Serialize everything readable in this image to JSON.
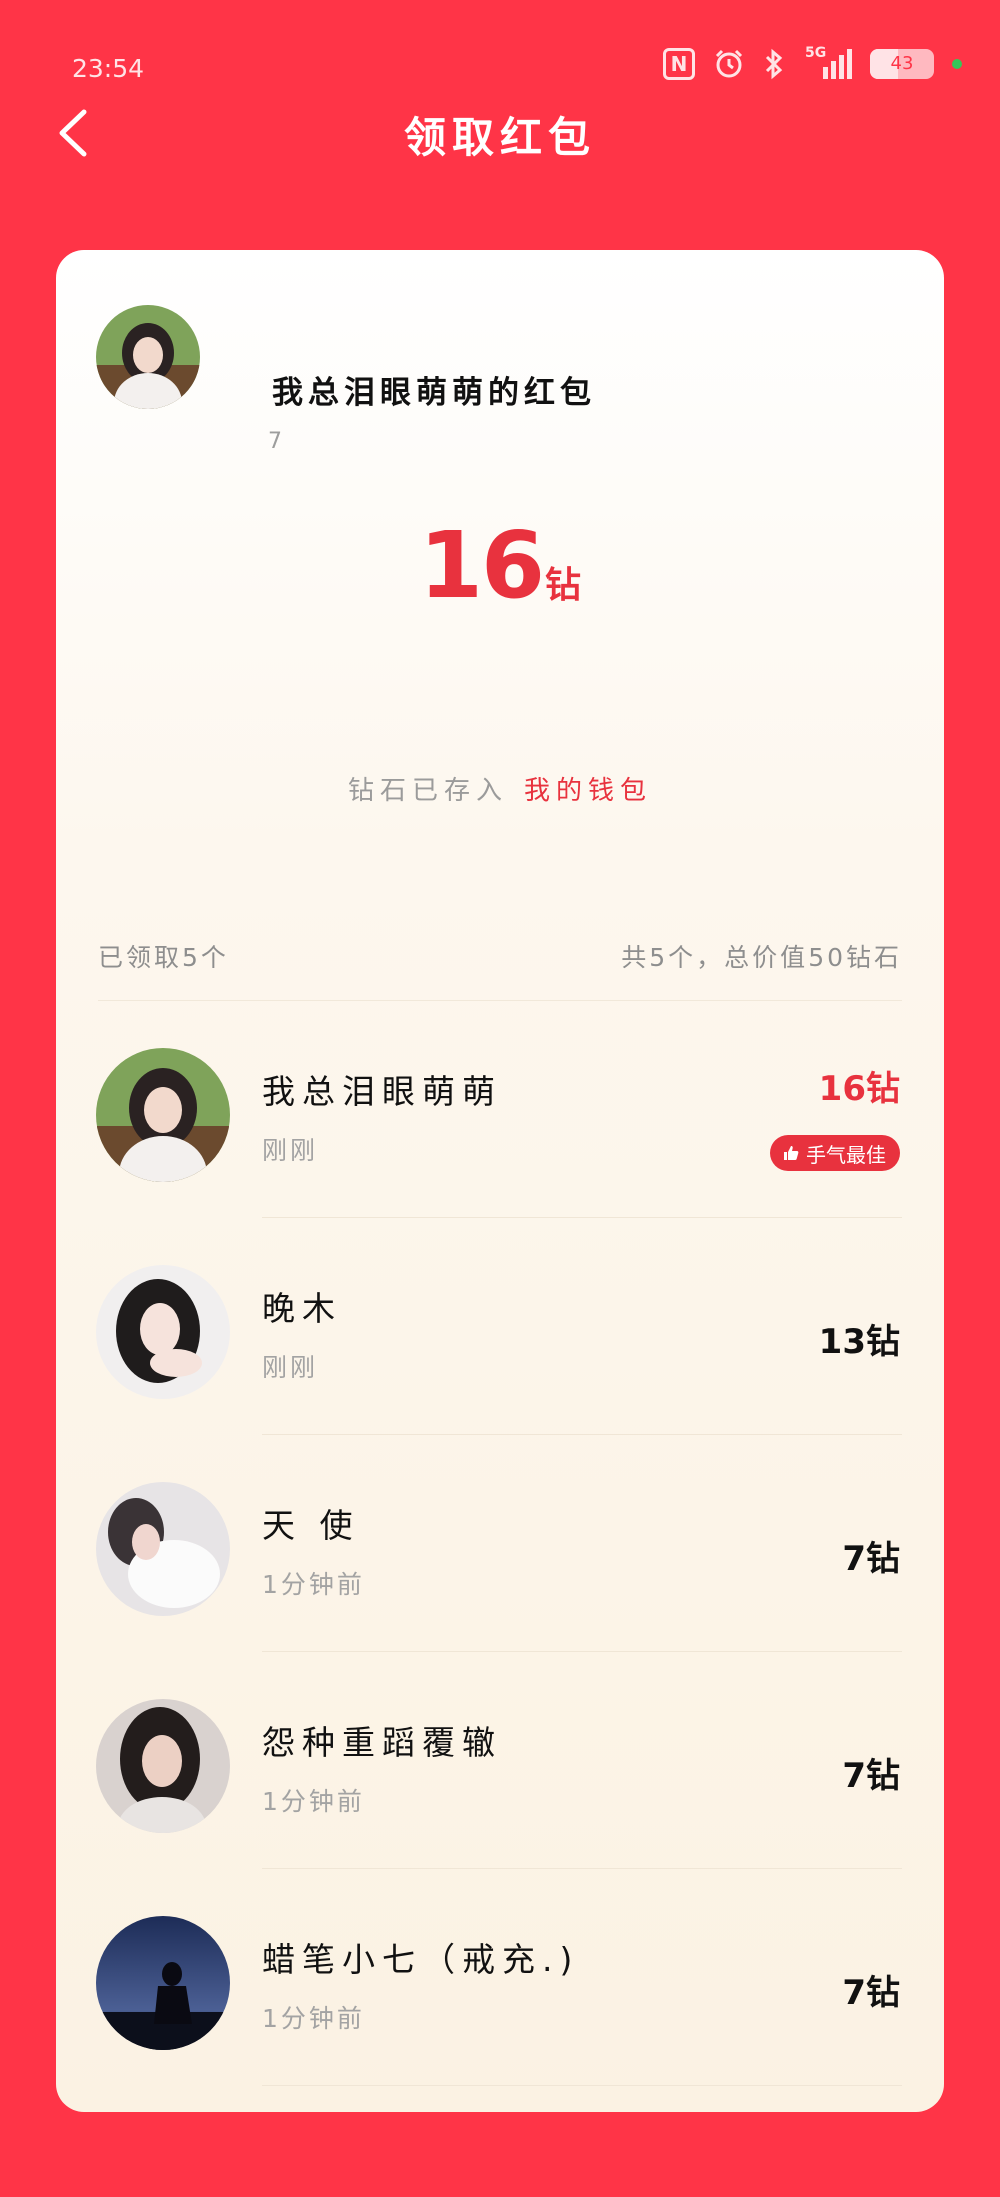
{
  "status_bar": {
    "time": "23:54",
    "network": "5G",
    "battery": "43",
    "battery_level": 0.43,
    "icons": [
      "nfc-icon",
      "alarm-icon",
      "bluetooth-icon",
      "signal-icon",
      "battery-icon"
    ]
  },
  "header": {
    "title": "领取红包",
    "back_icon": "chevron-left-icon"
  },
  "sender": {
    "name": "我总泪眼萌萌的红包",
    "sub": "7"
  },
  "amount": {
    "value": "16",
    "unit": "钻"
  },
  "wallet_note": {
    "text": "钻石已存入",
    "link": "我的钱包"
  },
  "summary": {
    "received": "已领取5个",
    "total": "共5个，总价值50钻石"
  },
  "recipients": [
    {
      "name": "我总泪眼萌萌",
      "time": "刚刚",
      "amount": "16钻",
      "badge": "手气最佳"
    },
    {
      "name": "晚木",
      "time": "刚刚",
      "amount": "13钻"
    },
    {
      "name": "天 使",
      "time": "1分钟前",
      "amount": "7钻"
    },
    {
      "name": "怨种重蹈覆辙",
      "time": "1分钟前",
      "amount": "7钻"
    },
    {
      "name": "蜡笔小七（戒充.)",
      "time": "1分钟前",
      "amount": "7钻"
    }
  ],
  "colors": {
    "background": "#FF3447",
    "accent": "#E8323E",
    "card": "#FDF7EE"
  }
}
